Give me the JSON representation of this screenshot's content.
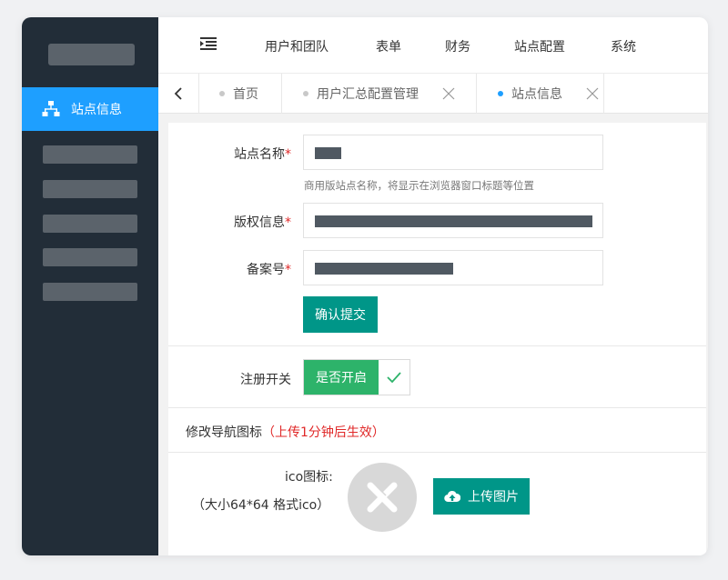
{
  "sidebar": {
    "active_item": {
      "label": "站点信息",
      "icon": "sitemap-icon"
    },
    "placeholder_count": 5
  },
  "topnav": {
    "menu_icon": "indent-menu-icon",
    "items": [
      "用户和团队",
      "表单",
      "财务",
      "站点配置",
      "系统"
    ]
  },
  "tabs": {
    "back_icon": "chevron-left-icon",
    "items": [
      {
        "label": "首页",
        "closable": false,
        "active": false
      },
      {
        "label": "用户汇总配置管理",
        "closable": true,
        "active": false
      },
      {
        "label": "站点信息",
        "closable": true,
        "active": true
      }
    ]
  },
  "form": {
    "site_name": {
      "label": "站点名称",
      "required": "*",
      "hint": "商用版站点名称，将显示在浏览器窗口标题等位置"
    },
    "copyright": {
      "label": "版权信息",
      "required": "*"
    },
    "icp": {
      "label": "备案号",
      "required": "*"
    },
    "submit_label": "确认提交"
  },
  "register": {
    "label": "注册开关",
    "toggle_label": "是否开启",
    "checked": true
  },
  "nav_icon": {
    "title": "修改导航图标",
    "notice": "（上传1分钟后生效）",
    "field_label": "ico图标:",
    "field_hint": "（大小64*64 格式ico）",
    "upload_label": "上传图片"
  },
  "colors": {
    "sidebar_bg": "#222d38",
    "accent_blue": "#1e9fff",
    "primary_green": "#009688",
    "switch_green": "#2db36a",
    "required_red": "#e02828"
  }
}
